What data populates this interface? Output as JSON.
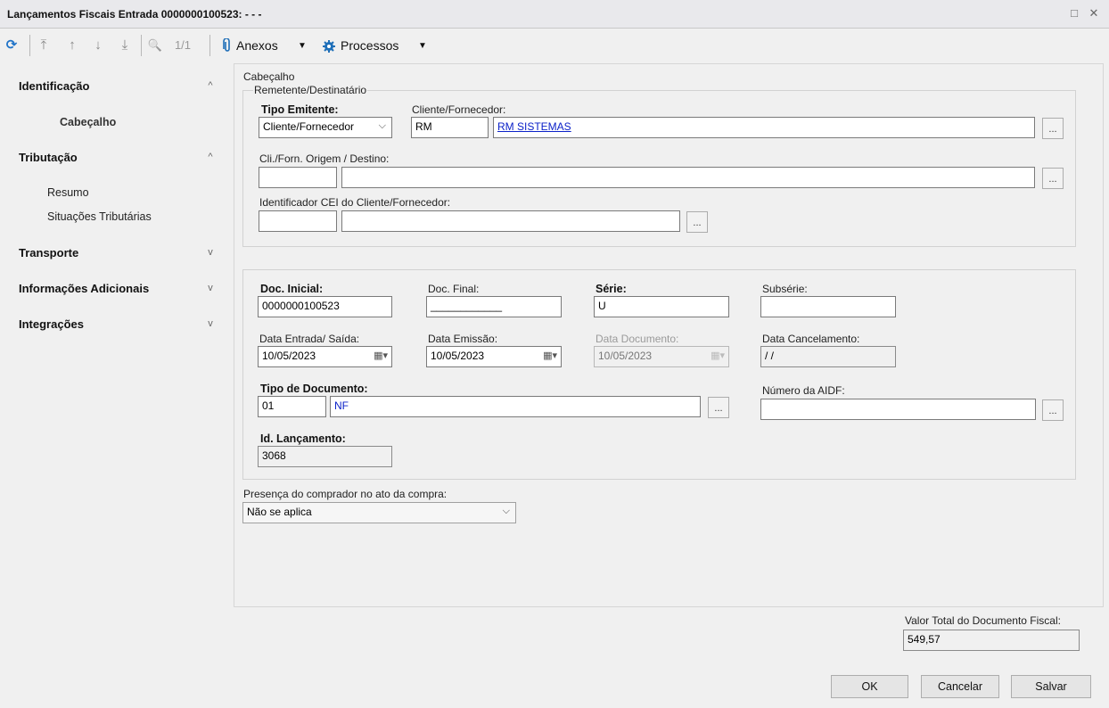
{
  "window": {
    "title": "Lançamentos Fiscais Entrada 0000000100523: - - -",
    "maximize_icon": "□",
    "close_icon": "✕"
  },
  "toolbar": {
    "refresh_icon": "⟳",
    "first_icon": "⤒",
    "prev_icon": "↑",
    "next_icon": "↓",
    "last_icon": "⤓",
    "search_icon": "🔍",
    "page_count": "1/1",
    "attachments_label": "Anexos",
    "processes_label": "Processos",
    "dropdown_caret": "▼"
  },
  "sidebar": {
    "sections": [
      {
        "label": "Identificação",
        "chevron": "^"
      },
      {
        "label": "Tributação",
        "chevron": "^"
      },
      {
        "label": "Transporte",
        "chevron": "v"
      },
      {
        "label": "Informações Adicionais",
        "chevron": "v"
      },
      {
        "label": "Integrações",
        "chevron": "v"
      }
    ],
    "subitems": {
      "cabecalho": "Cabeçalho",
      "resumo": "Resumo",
      "situacoes": "Situações Tributárias"
    }
  },
  "form": {
    "header_title": "Cabeçalho",
    "sender_group_title": "Remetente/Destinatário",
    "tipo_emitente_label": "Tipo Emitente:",
    "tipo_emitente_value": "Cliente/Fornecedor",
    "cliente_label": "Cliente/Fornecedor:",
    "cliente_code": "RM",
    "cliente_name": "RM SISTEMAS",
    "origem_label": "Cli./Forn. Origem / Destino:",
    "origem_code": "",
    "origem_name": "",
    "cei_label": "Identificador CEI do Cliente/Fornecedor:",
    "cei_code": "",
    "cei_name": "",
    "lookup_button": "...",
    "doc_inicial_label": "Doc. Inicial:",
    "doc_inicial_value": "0000000100523",
    "doc_final_label": "Doc. Final:",
    "doc_final_value": "____________",
    "serie_label": "Série:",
    "serie_value": "U",
    "subserie_label": "Subsérie:",
    "subserie_value": "",
    "data_entrada_label": "Data Entrada/ Saída:",
    "data_entrada_value": "10/05/2023",
    "data_emissao_label": "Data Emissão:",
    "data_emissao_value": "10/05/2023",
    "data_documento_label": "Data Documento:",
    "data_documento_value": "10/05/2023",
    "data_cancelamento_label": "Data Cancelamento:",
    "data_cancelamento_value": " / /",
    "tipo_documento_label": "Tipo de Documento:",
    "tipo_documento_code": "01",
    "tipo_documento_name": "NF",
    "numero_aidf_label": "Número da AIDF:",
    "numero_aidf_value": "",
    "id_lancamento_label": "Id. Lançamento:",
    "id_lancamento_value": "3068",
    "presenca_label": "Presença do comprador no ato da compra:",
    "presenca_value": "Não se aplica",
    "calendar_icon": "▦▾"
  },
  "footer": {
    "total_label": "Valor Total do Documento Fiscal:",
    "total_value": "549,57",
    "ok_label": "OK",
    "cancel_label": "Cancelar",
    "save_label": "Salvar"
  }
}
